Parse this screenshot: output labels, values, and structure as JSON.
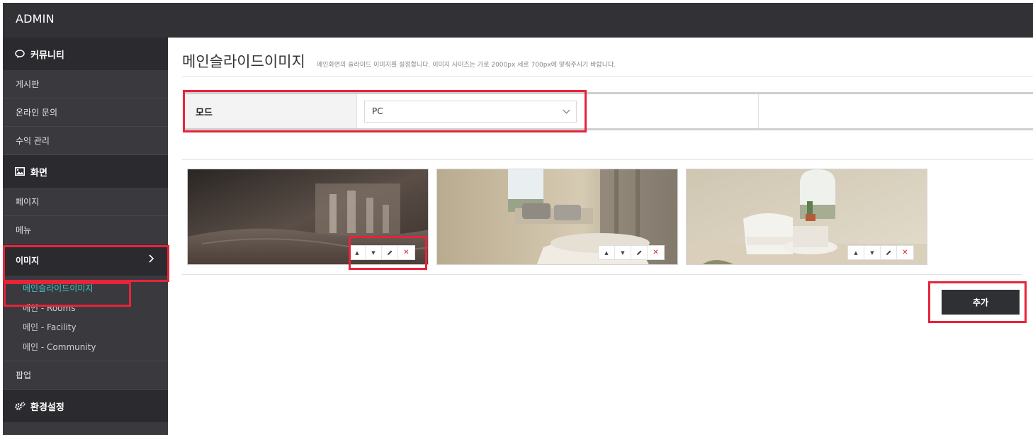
{
  "app": {
    "brand": "ADMIN"
  },
  "sidebar": {
    "community": {
      "header": "커뮤니티",
      "items": [
        "게시판",
        "온라인 문의",
        "수익 관리"
      ]
    },
    "display": {
      "header": "화면",
      "items": [
        "페이지",
        "메뉴"
      ],
      "active": "이미지",
      "sub_items": [
        "메인슬라이드이미지",
        "메인 - Rooms",
        "메인 - Facility",
        "메인 - Community"
      ],
      "after": "팝업"
    },
    "settings": {
      "header": "환경설정"
    }
  },
  "main": {
    "title": "메인슬라이드이미지",
    "description": "메인화면의 슬라이드 이미지를 설정합니다. 이미지 사이즈는 가로 2000px 세로 700px에 맞춰주시기 바랍니다.",
    "mode_label": "모드",
    "mode_value": "PC",
    "add_button": "추가",
    "slides": [
      {
        "icon": "bedroom-photo-icon"
      },
      {
        "icon": "lounge-photo-icon"
      },
      {
        "icon": "chair-photo-icon"
      }
    ]
  },
  "colors": {
    "topbar": "#323236",
    "sidebar": "#3a3a3e",
    "active_sub": "#3ec7c4",
    "highlight": "#e8233a",
    "button": "#2f3034"
  }
}
